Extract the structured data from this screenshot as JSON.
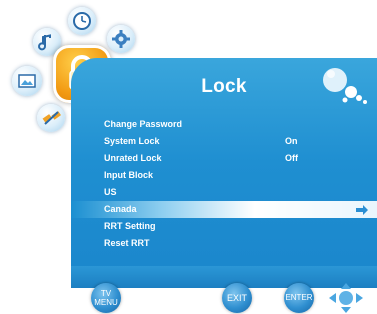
{
  "panel": {
    "title": "Lock"
  },
  "menu": {
    "items": [
      {
        "label": "Change Password",
        "value": ""
      },
      {
        "label": "System Lock",
        "value": "On"
      },
      {
        "label": "Unrated Lock",
        "value": "Off"
      },
      {
        "label": "Input Block",
        "value": ""
      },
      {
        "label": "US",
        "value": ""
      },
      {
        "label": "Canada",
        "value": "",
        "selected": true
      },
      {
        "label": "RRT Setting",
        "value": ""
      },
      {
        "label": "Reset RRT",
        "value": ""
      }
    ]
  },
  "footer": {
    "tv_menu_line1": "TV",
    "tv_menu_line2": "MENU",
    "exit_label": "EXIT",
    "enter_label": "ENTER"
  },
  "side_icons": [
    "clock-icon",
    "music-icon",
    "settings-icon",
    "picture-icon",
    "lock-icon",
    "satellite-icon"
  ],
  "colors": {
    "panel_blue": "#1f8fd1",
    "text": "#ffffff",
    "highlight": "#ffffff",
    "lock_orange": "#f29a12"
  }
}
